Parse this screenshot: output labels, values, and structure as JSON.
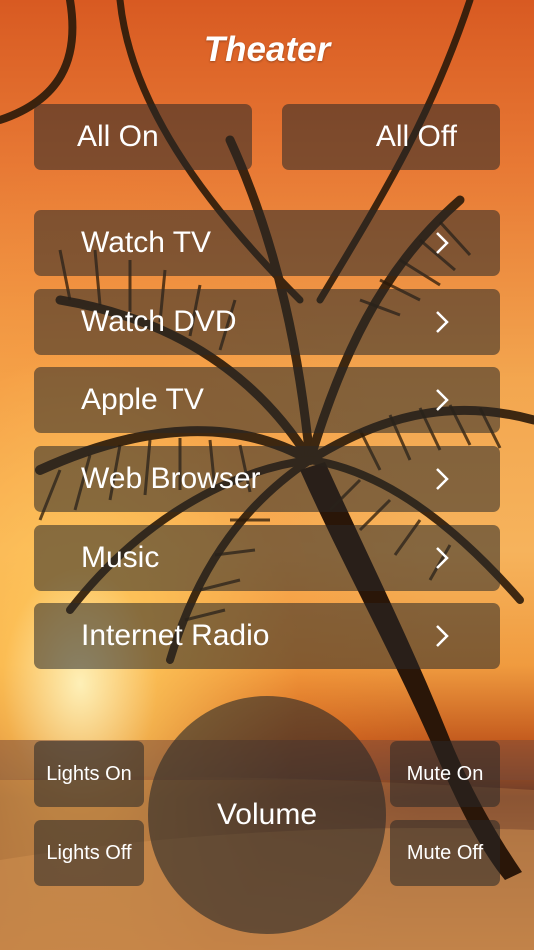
{
  "header": {
    "title": "Theater"
  },
  "top_buttons": {
    "all_on": "All On",
    "all_off": "All Off"
  },
  "menu": {
    "items": [
      {
        "label": "Watch TV"
      },
      {
        "label": "Watch DVD"
      },
      {
        "label": "Apple TV"
      },
      {
        "label": "Web Browser"
      },
      {
        "label": "Music"
      },
      {
        "label": "Internet Radio"
      }
    ]
  },
  "controls": {
    "lights_on": "Lights On",
    "lights_off": "Lights Off",
    "volume": "Volume",
    "mute_on": "Mute On",
    "mute_off": "Mute Off"
  },
  "colors": {
    "button_bg": "#282828",
    "text": "#ffffff",
    "sky_top": "#d85a22",
    "sky_mid": "#f6b35c"
  },
  "icons": {
    "menu_chevron": "chevron-right-icon"
  }
}
